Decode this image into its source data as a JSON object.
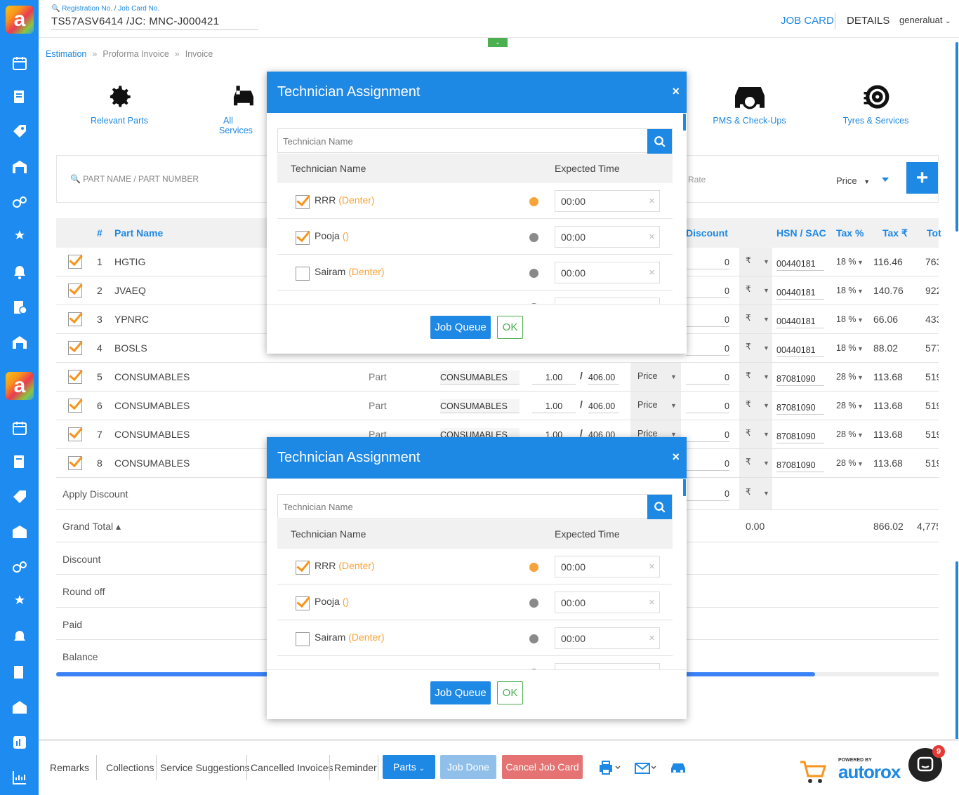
{
  "header": {
    "reg_label": "Registration No. / Job Card No.",
    "reg_value": "TS57ASV6414 /JC: MNC-J000421",
    "job_card_tab": "JOB CARD",
    "details_tab": "DETAILS",
    "user": "generaluat"
  },
  "breadcrumb": [
    "Estimation",
    "Proforma Invoice",
    "Invoice"
  ],
  "categories": [
    "Relevant Parts",
    "All Services",
    "PMS & Check-Ups",
    "Tyres & Services"
  ],
  "search": {
    "part_placeholder": "PART NAME / PART NUMBER",
    "rate_placeholder": "Rate",
    "price_select": "Price"
  },
  "table": {
    "headers": {
      "num": "#",
      "part_name": "Part Name",
      "discount": "Discount",
      "hsn": "HSN / SAC",
      "tax_pct": "Tax %",
      "tax_amt": "Tax ₹",
      "total": "Tot"
    },
    "rows": [
      {
        "num": "1",
        "name": "HGTIG",
        "discount": "0",
        "currency": "₹",
        "hsn": "00440181",
        "tax_pct": "18 %",
        "tax_amt": "116.46",
        "total": "763"
      },
      {
        "num": "2",
        "name": "JVAEQ",
        "discount": "0",
        "currency": "₹",
        "hsn": "00440181",
        "tax_pct": "18 %",
        "tax_amt": "140.76",
        "total": "922"
      },
      {
        "num": "3",
        "name": "YPNRC",
        "discount": "0",
        "currency": "₹",
        "hsn": "00440181",
        "tax_pct": "18 %",
        "tax_amt": "66.06",
        "total": "433"
      },
      {
        "num": "4",
        "name": "BOSLS",
        "discount": "0",
        "currency": "₹",
        "hsn": "00440181",
        "tax_pct": "18 %",
        "tax_amt": "88.02",
        "total": "577"
      },
      {
        "num": "5",
        "name": "CONSUMABLES",
        "type": "Part",
        "group": "CONSUMABLES",
        "qty": "1.00",
        "rate": "406.00",
        "price": "Price",
        "discount": "0",
        "currency": "₹",
        "hsn": "87081090",
        "tax_pct": "28 %",
        "tax_amt": "113.68",
        "total": "519"
      },
      {
        "num": "6",
        "name": "CONSUMABLES",
        "type": "Part",
        "group": "CONSUMABLES",
        "qty": "1.00",
        "rate": "406.00",
        "price": "Price",
        "discount": "0",
        "currency": "₹",
        "hsn": "87081090",
        "tax_pct": "28 %",
        "tax_amt": "113.68",
        "total": "519"
      },
      {
        "num": "7",
        "name": "CONSUMABLES",
        "type": "Part",
        "group": "CONSUMABLES",
        "qty": "1.00",
        "rate": "406.00",
        "price": "Price",
        "discount": "0",
        "currency": "₹",
        "hsn": "87081090",
        "tax_pct": "28 %",
        "tax_amt": "113.68",
        "total": "519"
      },
      {
        "num": "8",
        "name": "CONSUMABLES",
        "discount": "0",
        "currency": "₹",
        "hsn": "87081090",
        "tax_pct": "28 %",
        "tax_amt": "113.68",
        "total": "519"
      }
    ],
    "apply_discount": {
      "label": "Apply Discount",
      "value": "0",
      "currency": "₹"
    },
    "grand_total": {
      "label": "Grand Total ▴",
      "discount_total": "0.00",
      "tax_total": "866.02",
      "total": "4,775"
    },
    "summary": [
      "Discount",
      "Round off",
      "Paid",
      "Balance"
    ],
    "scroll_progress": 0.86
  },
  "modal": {
    "title": "Technician Assignment",
    "close": "×",
    "search_placeholder": "Technician Name",
    "col_name": "Technician Name",
    "col_time": "Expected Time",
    "technicians": [
      {
        "name": "RRR",
        "role": "(Denter)",
        "checked": true,
        "status_color": "#f7a33a",
        "time": "00:00"
      },
      {
        "name": "Pooja",
        "role": "()",
        "checked": true,
        "status_color": "#8a8a8a",
        "time": "00:00"
      },
      {
        "name": "Sairam",
        "role": "(Denter)",
        "checked": false,
        "status_color": "#8a8a8a",
        "time": "00:00"
      }
    ],
    "job_queue_label": "Job Queue",
    "ok_label": "OK"
  },
  "bottom": {
    "links": [
      "Remarks",
      "Collections",
      "Service Suggestions",
      "Cancelled Invoices",
      "Reminder"
    ],
    "parts_btn": "Parts",
    "job_done_btn": "Job Done",
    "cancel_btn": "Cancel Job Card",
    "chat_badge": "9",
    "powered_by": "POWERED BY",
    "brand": "autorox"
  },
  "colors": {
    "primary": "#1e88e5",
    "accent": "#f7941d",
    "success": "#4caf50",
    "danger": "#e57373"
  }
}
